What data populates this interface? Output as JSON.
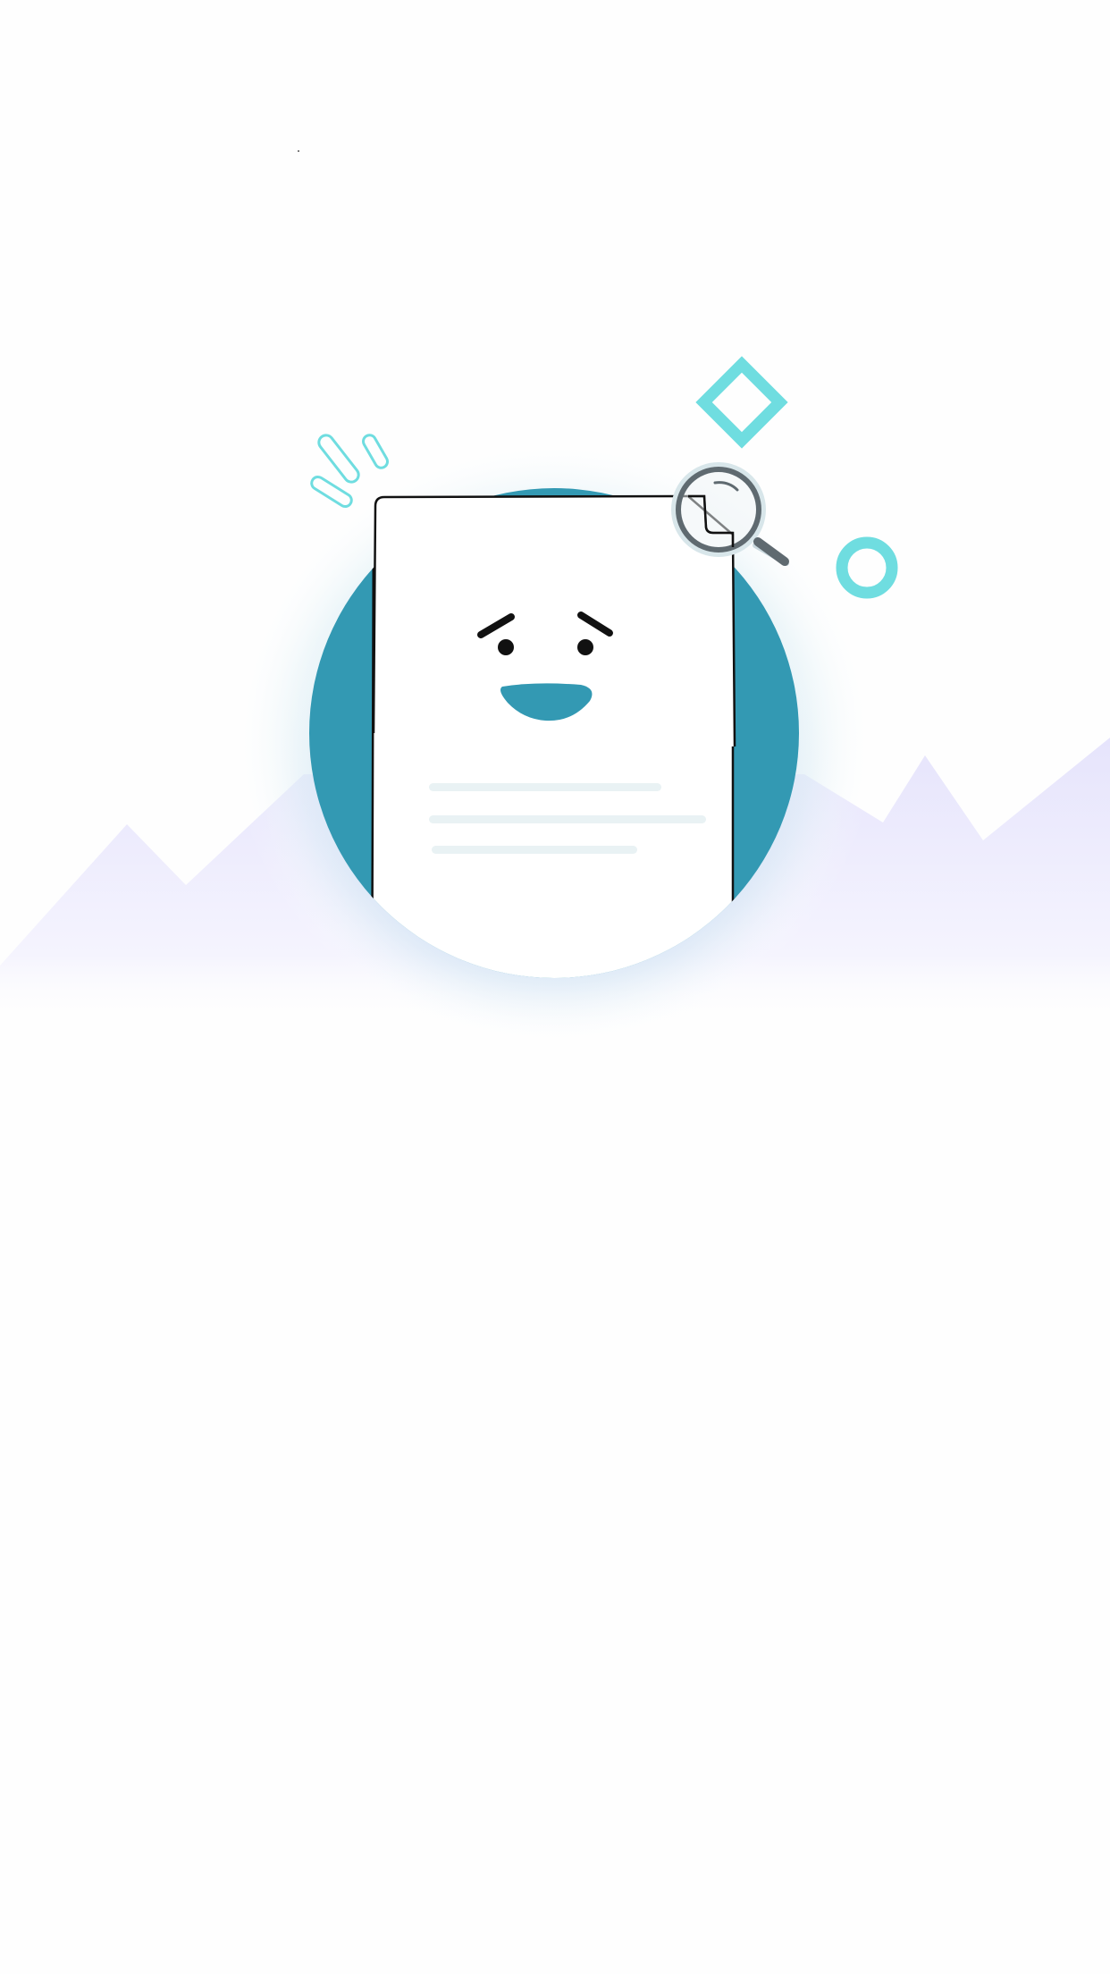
{
  "illustration": {
    "name": "empty-state-illustration",
    "icons": [
      "sad-document-icon",
      "magnifier-icon",
      "diamond-icon",
      "ring-icon",
      "sparkle-lines-icon",
      "mountains-icon"
    ]
  },
  "colors": {
    "circle": "#3399b3",
    "accent": "#6fdde0",
    "mountain": "#ebeafd",
    "magnifier": "#5f6a70",
    "text_lines": "#e9f2f4"
  }
}
